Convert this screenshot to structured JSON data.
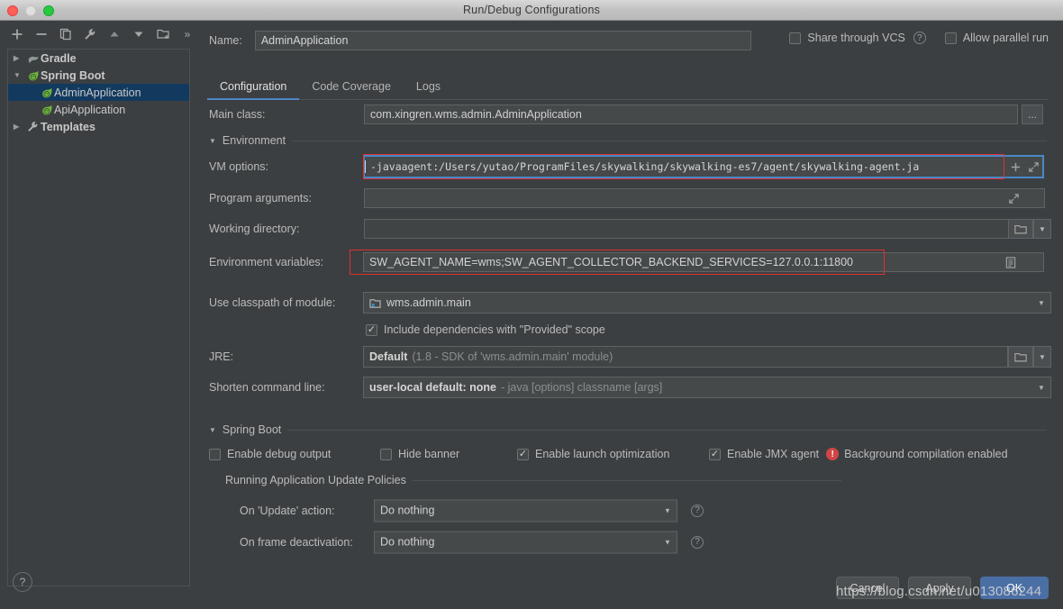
{
  "window": {
    "title": "Run/Debug Configurations",
    "traffic_lights": [
      "close",
      "minimize",
      "maximize"
    ]
  },
  "sidebar": {
    "toolbar": [
      {
        "name": "add-icon",
        "glyph": "+"
      },
      {
        "name": "remove-icon",
        "glyph": "−"
      },
      {
        "name": "copy-icon",
        "glyph": "copy"
      },
      {
        "name": "edit-templates-icon",
        "glyph": "wrench"
      },
      {
        "name": "move-up-icon",
        "glyph": "▲"
      },
      {
        "name": "move-down-icon",
        "glyph": "▼"
      },
      {
        "name": "new-folder-icon",
        "glyph": "folder-plus"
      },
      {
        "name": "more-icon",
        "glyph": "»"
      }
    ],
    "tree": [
      {
        "label": "Gradle",
        "level": 1,
        "expanded": false,
        "icon": "gradle-elephant-icon",
        "selected": false
      },
      {
        "label": "Spring Boot",
        "level": 1,
        "expanded": true,
        "icon": "spring-boot-leaf-icon",
        "selected": false
      },
      {
        "label": "AdminApplication",
        "level": 2,
        "icon": "spring-boot-leaf-icon",
        "selected": true
      },
      {
        "label": "ApiApplication",
        "level": 2,
        "icon": "spring-boot-leaf-icon",
        "selected": false
      },
      {
        "label": "Templates",
        "level": 1,
        "expanded": false,
        "icon": "wrench-icon",
        "selected": false
      }
    ],
    "help_label": "?"
  },
  "header": {
    "name_label": "Name:",
    "name_value": "AdminApplication",
    "share_vcs_label": "Share through VCS",
    "share_vcs_checked": false,
    "share_vcs_help": "?",
    "allow_parallel_label": "Allow parallel run",
    "allow_parallel_checked": false
  },
  "tabs": [
    {
      "label": "Configuration",
      "active": true
    },
    {
      "label": "Code Coverage",
      "active": false
    },
    {
      "label": "Logs",
      "active": false
    }
  ],
  "configuration": {
    "main_class": {
      "label": "Main class:",
      "value": "com.xingren.wms.admin.AdminApplication",
      "browse_label": "..."
    },
    "environment_section": "Environment",
    "vm_options": {
      "label": "VM options:",
      "value": "-javaagent:/Users/yutao/ProgramFiles/skywalking/skywalking-es7/agent/skywalking-agent.ja",
      "highlighted": true
    },
    "program_arguments": {
      "label": "Program arguments:",
      "value": ""
    },
    "working_directory": {
      "label": "Working directory:",
      "value": ""
    },
    "environment_variables": {
      "label": "Environment variables:",
      "value": "SW_AGENT_NAME=wms;SW_AGENT_COLLECTOR_BACKEND_SERVICES=127.0.0.1:11800",
      "highlighted": true
    },
    "use_classpath": {
      "label": "Use classpath of module:",
      "value": "wms.admin.main"
    },
    "include_provided": {
      "label": "Include dependencies with \"Provided\" scope",
      "checked": true
    },
    "jre": {
      "label": "JRE:",
      "value": "Default",
      "hint": "(1.8 - SDK of 'wms.admin.main' module)"
    },
    "shorten_command_line": {
      "label": "Shorten command line:",
      "value": "user-local default: none",
      "hint": "- java [options] classname [args]"
    }
  },
  "spring_boot": {
    "section_title": "Spring Boot",
    "checks": [
      {
        "label": "Enable debug output",
        "checked": false
      },
      {
        "label": "Hide banner",
        "checked": false
      },
      {
        "label": "Enable launch optimization",
        "checked": true
      },
      {
        "label": "Enable JMX agent",
        "checked": true
      }
    ],
    "warning_text": "Background compilation enabled",
    "policies_title": "Running Application Update Policies",
    "on_update_action": {
      "label": "On 'Update' action:",
      "value": "Do nothing",
      "help": "?"
    },
    "on_frame_deactivation": {
      "label": "On frame deactivation:",
      "value": "Do nothing",
      "help": "?"
    }
  },
  "footer": {
    "cancel_label": "Cancel",
    "apply_label": "Apply",
    "ok_label": "OK",
    "watermark": "https://blog.csdn.net/u013086244"
  },
  "colors": {
    "accent": "#4a88c7",
    "selection": "#123a5f",
    "highlight_border": "#e03030",
    "warning": "#d14545",
    "primary_button": "#4a6fa5",
    "panel_bg": "#3c3f41",
    "field_bg": "#45494a"
  }
}
